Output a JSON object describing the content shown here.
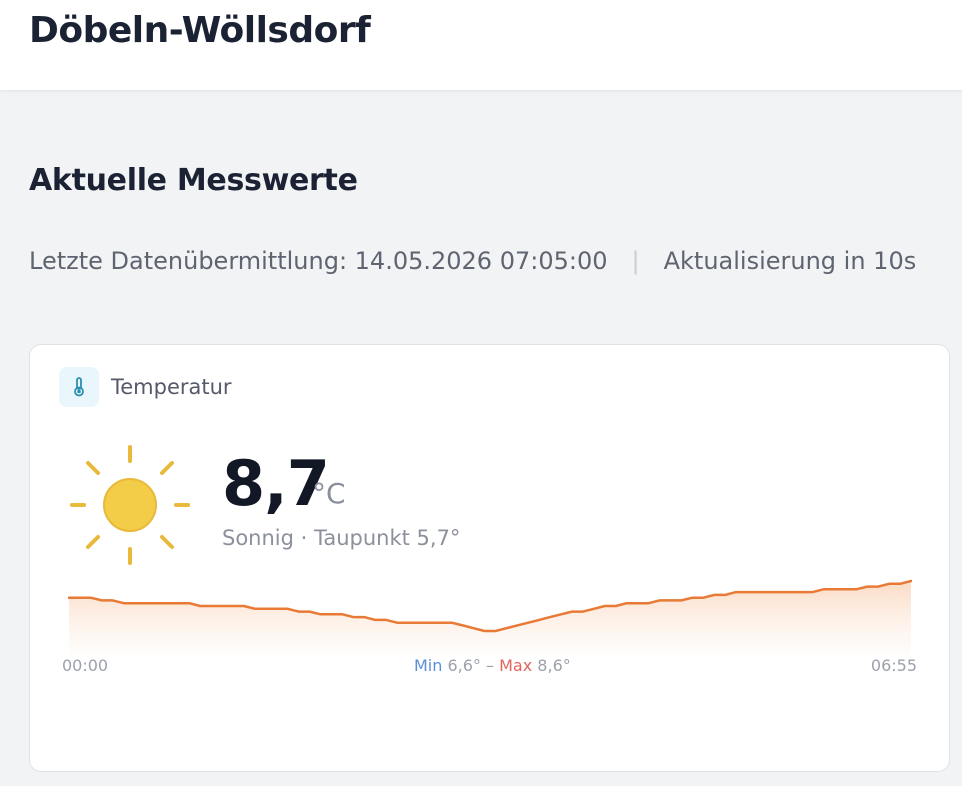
{
  "header": {
    "location": "Döbeln-Wöllsdorf"
  },
  "section": {
    "title": "Aktuelle Messwerte"
  },
  "status": {
    "last_transmission": "Letzte Datenübermittlung: 14.05.2026 07:05:00",
    "separator": "|",
    "refresh": "Aktualisierung in 10s"
  },
  "card": {
    "label": "Temperatur",
    "icon": "thermometer-icon",
    "weather_icon": "sun-icon",
    "value": "8,7",
    "unit": "°C",
    "condition": "Sonnig · Taupunkt 5,7°",
    "colors": {
      "line": "#e87a35",
      "fill_top": "#fbd9c1",
      "sun": "#f3cd47",
      "sun_rays": "#e8b93a",
      "min": "#5b8fd8",
      "max": "#e26660"
    }
  },
  "chart_data": {
    "type": "area",
    "x_start_label": "00:00",
    "x_end_label": "06:55",
    "min_label": "Min",
    "min_value": "6,6°",
    "dash": "–",
    "max_label": "Max",
    "max_value": "8,6°",
    "ylim": [
      6.6,
      8.6
    ],
    "values": [
      8.6,
      8.6,
      8.6,
      8.55,
      8.55,
      8.5,
      8.5,
      8.5,
      8.5,
      8.5,
      8.5,
      8.5,
      8.45,
      8.45,
      8.45,
      8.45,
      8.45,
      8.4,
      8.4,
      8.4,
      8.4,
      8.35,
      8.35,
      8.3,
      8.3,
      8.3,
      8.25,
      8.25,
      8.2,
      8.2,
      8.15,
      8.15,
      8.15,
      8.15,
      8.15,
      8.15,
      8.1,
      8.05,
      8.0,
      8.0,
      8.05,
      8.1,
      8.15,
      8.2,
      8.25,
      8.3,
      8.35,
      8.35,
      8.4,
      8.45,
      8.45,
      8.5,
      8.5,
      8.5,
      8.55,
      8.55,
      8.55,
      8.6,
      8.6,
      8.65,
      8.65,
      8.7,
      8.7,
      8.7,
      8.7,
      8.7,
      8.7,
      8.7,
      8.7,
      8.75,
      8.75,
      8.75,
      8.75,
      8.8,
      8.8,
      8.85,
      8.85,
      8.9
    ]
  }
}
